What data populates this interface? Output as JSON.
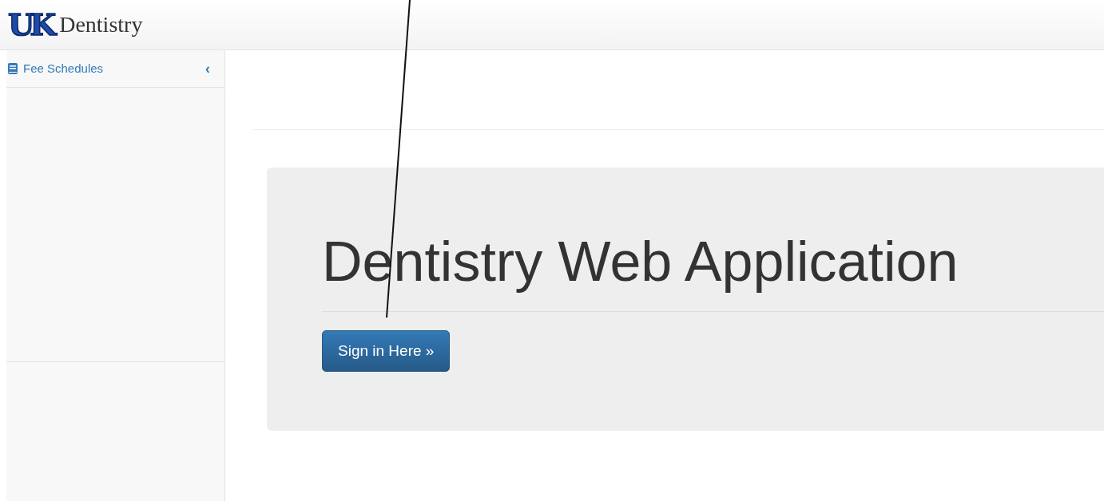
{
  "header": {
    "logo_text": "UK",
    "title": "Dentistry"
  },
  "sidebar": {
    "items": [
      {
        "label": "Fee Schedules",
        "icon": "‹",
        "expanded": false
      }
    ]
  },
  "jumbotron": {
    "heading": "Dentistry Web Application",
    "button": "Sign in Here »"
  }
}
